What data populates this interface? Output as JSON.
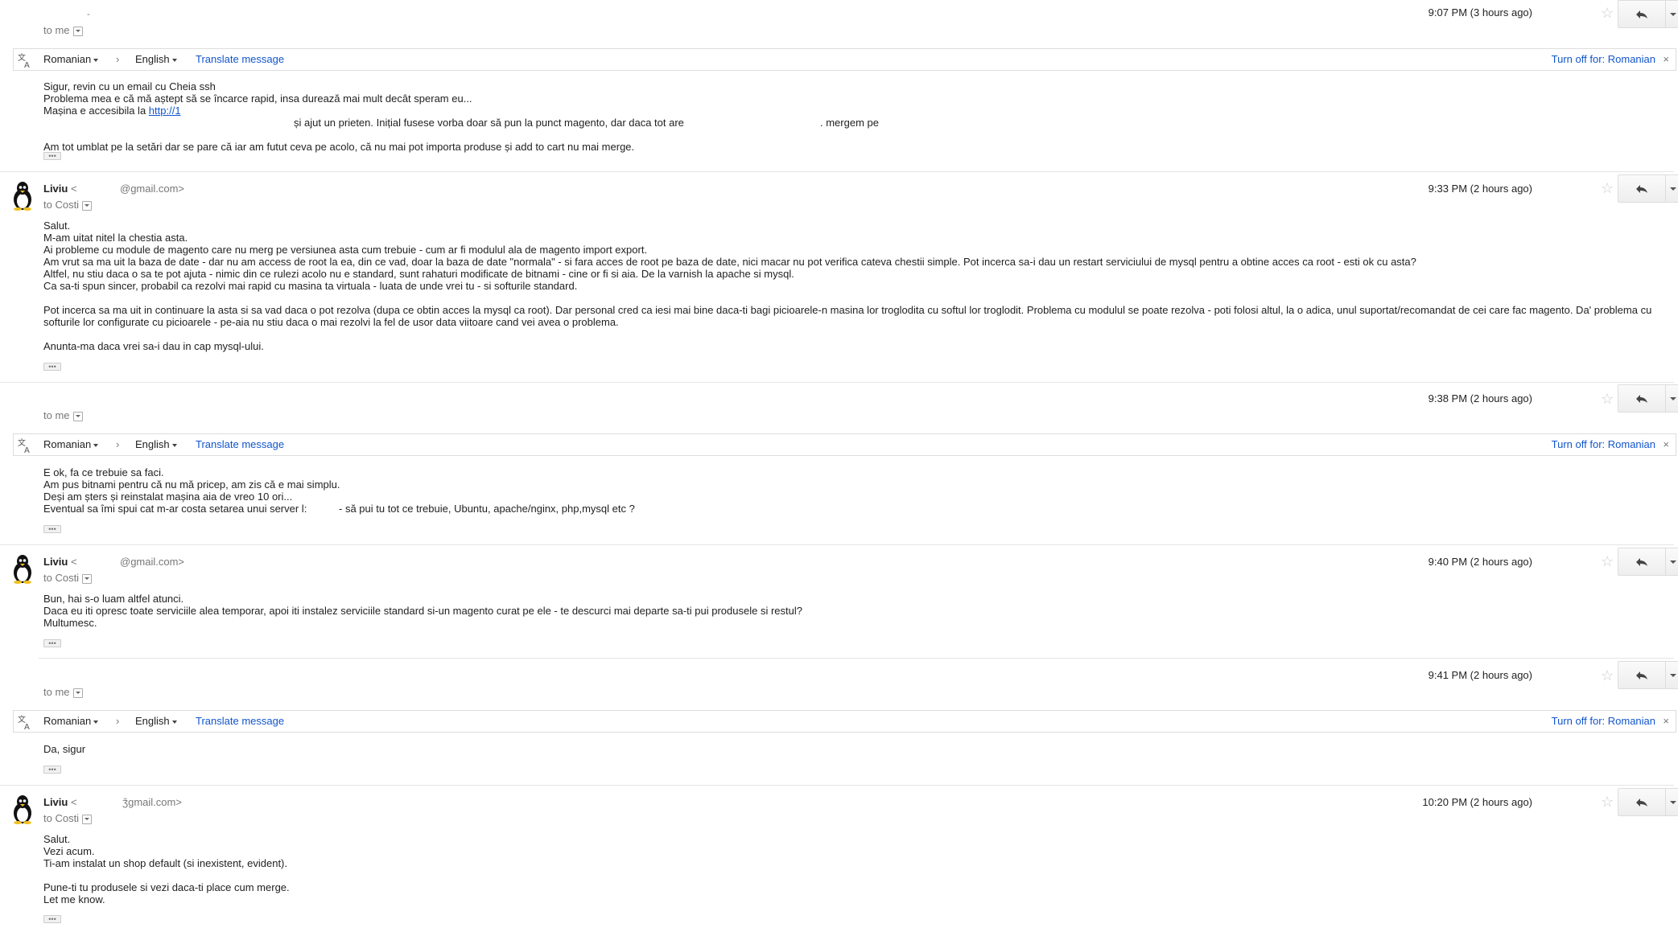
{
  "icons": {
    "reply": "reply-icon",
    "star": "star-icon",
    "translate": "translate-icon",
    "more": "chevron-down-icon",
    "close": "close-icon",
    "avatar": "tux-penguin-avatar"
  },
  "colors": {
    "link": "#1155cc",
    "divider": "#e5e5e5",
    "text": "#222222"
  },
  "translate_bar": {
    "from_lang": "Romanian",
    "to_lang": "English",
    "translate_link": "Translate message",
    "turn_off": "Turn off for: Romanian",
    "arrow": "›",
    "close": "×"
  },
  "messages": [
    {
      "id": "m1",
      "sender_tail": "-",
      "to": "to me",
      "time": "9:07 PM (3 hours ago)",
      "lines": [
        "Sigur, revin cu un email cu Cheia ssh",
        "Problema mea e că mă aștept să se încarce rapid, insa durează mai mult decât speram eu...",
        "Mașina e accesibila la ",
        "și ajut un prieten. Inițial fusese vorba doar să pun la punct magento, dar daca tot are",
        ". mergem pe",
        "Am tot umblat pe la setări dar se pare că iar am futut ceva pe acolo, că nu mai pot importa produse și add to cart nu mai merge."
      ],
      "link_text": "http://1"
    },
    {
      "id": "m2",
      "sender_name": "Liviu",
      "sender_open": "<",
      "sender_email": "@gmail.com>",
      "to": "to Costi",
      "time": "9:33 PM (2 hours ago)",
      "lines": [
        "Salut.",
        "M-am uitat nitel la chestia asta.",
        "Ai probleme cu module de magento care nu merg pe versiunea asta cum trebuie - cum ar fi modulul ala de magento import export.",
        "Am vrut sa ma uit la baza de date - dar nu am access de root la ea, din ce vad, doar la baza de date \"normala\" - si fara acces de root pe baza de date, nici macar nu pot verifica cateva chestii simple. Pot incerca sa-i dau un restart serviciului de mysql pentru a obtine acces ca root - esti ok cu asta?",
        "Altfel, nu stiu daca o sa te pot ajuta - nimic din ce rulezi acolo nu e standard, sunt rahaturi modificate de bitnami - cine or fi si aia. De la varnish la apache si mysql.",
        "Ca sa-ti spun sincer, probabil ca rezolvi mai rapid cu masina ta virtuala - luata de unde vrei tu - si softurile standard.",
        "",
        "Pot incerca sa ma uit in continuare la asta si sa vad daca o pot rezolva (dupa ce obtin acces la mysql ca root). Dar personal cred ca iesi mai bine daca-ti bagi picioarele-n masina lor troglodita cu softul lor troglodit. Problema cu modulul se poate rezolva - poti folosi altul, la o adica, unul suportat/recomandat de cei care fac magento. Da' problema cu",
        "softurile lor configurate cu picioarele - pe-aia nu stiu daca o mai rezolvi la fel de usor data viitoare cand vei avea o problema.",
        "",
        "Anunta-ma daca vrei sa-i dau in cap mysql-ului."
      ]
    },
    {
      "id": "m3",
      "to": "to me",
      "time": "9:38 PM (2 hours ago)",
      "lines": [
        "E ok, fa ce trebuie sa faci.",
        "Am pus bitnami pentru că nu mă pricep, am zis că e mai simplu.",
        "Deși am șters și reinstalat  mașina aia de  vreo 10 ori...",
        "Eventual sa îmi spui cat m-ar costa setarea unui server l:",
        "- să pui tu tot ce trebuie, Ubuntu, apache/nginx, php,mysql etc ?"
      ]
    },
    {
      "id": "m4",
      "sender_name": "Liviu",
      "sender_open": "<",
      "sender_email": "@gmail.com>",
      "to": "to Costi",
      "time": "9:40 PM (2 hours ago)",
      "lines": [
        "Bun, hai s-o luam altfel atunci.",
        "Daca eu iti opresc toate serviciile alea temporar, apoi iti instalez serviciile standard si-un magento curat pe ele - te descurci mai departe sa-ti pui produsele si restul?",
        "Multumesc."
      ]
    },
    {
      "id": "m5",
      "to": "to me",
      "time": "9:41 PM (2 hours ago)",
      "lines": [
        "Da, sigur"
      ]
    },
    {
      "id": "m6",
      "sender_name": "Liviu",
      "sender_open": "<",
      "sender_email": "ǯgmail.com>",
      "to": "to Costi",
      "time": "10:20 PM (2 hours ago)",
      "lines": [
        "Salut.",
        "Vezi acum.",
        "Ti-am instalat un shop default (si inexistent, evident).",
        "",
        "Pune-ti tu produsele si vezi daca-ti place cum merge.",
        "Let me know."
      ]
    }
  ]
}
